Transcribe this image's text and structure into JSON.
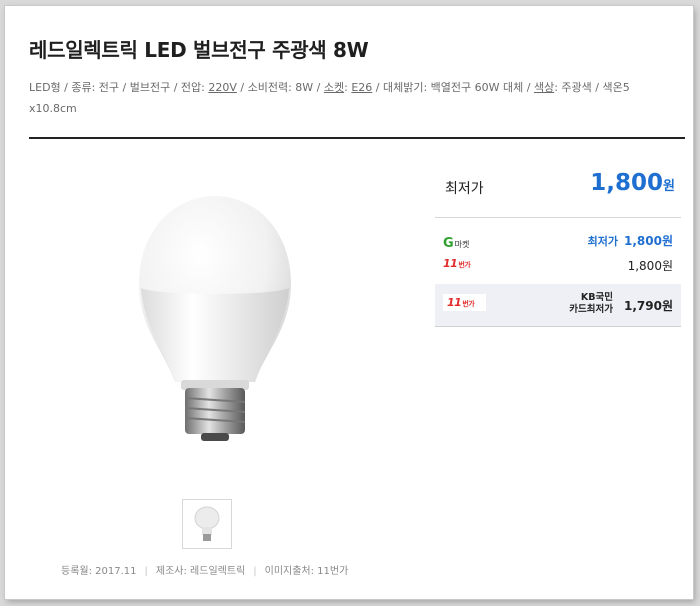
{
  "product": {
    "title": "레드일렉트릭 LED 벌브전구 주광색 8W",
    "specs": [
      {
        "text": "LED형 / 종류: 전구 / 벌브전구 / 전압: "
      },
      {
        "text": "220V",
        "underline": true
      },
      {
        "text": " / 소비전력: 8W / "
      },
      {
        "text": "소켓",
        "underline": true
      },
      {
        "text": ": "
      },
      {
        "text": "E26",
        "underline": true
      },
      {
        "text": " / 대체밝기: 백열전구 60W 대체 / "
      },
      {
        "text": "색상",
        "underline": true
      },
      {
        "text": ": 주광색 / 색온5 x10.8cm"
      }
    ]
  },
  "price": {
    "lowest_label": "최저가",
    "lowest_value": "1,800",
    "currency": "원",
    "offers": [
      {
        "store_logo": "G",
        "store_sub": "마켓",
        "tag": "최저가",
        "price": "1,800원",
        "highlight": true
      },
      {
        "store_logo": "11",
        "store_sub": "번가",
        "price": "1,800원"
      },
      {
        "store_logo": "11",
        "store_sub": "번가",
        "card_line1": "KB국민",
        "card_line2": "카드최저가",
        "price": "1,790원"
      }
    ]
  },
  "meta": {
    "registered": "등록월: 2017.11",
    "maker": "제조사: 레드일렉트릭",
    "image_source": "이미지출처: 11번가"
  },
  "colors": {
    "accent_blue": "#1f6fd0",
    "gmarket_green": "#2fa12d",
    "st11_red": "#e12b2b"
  }
}
